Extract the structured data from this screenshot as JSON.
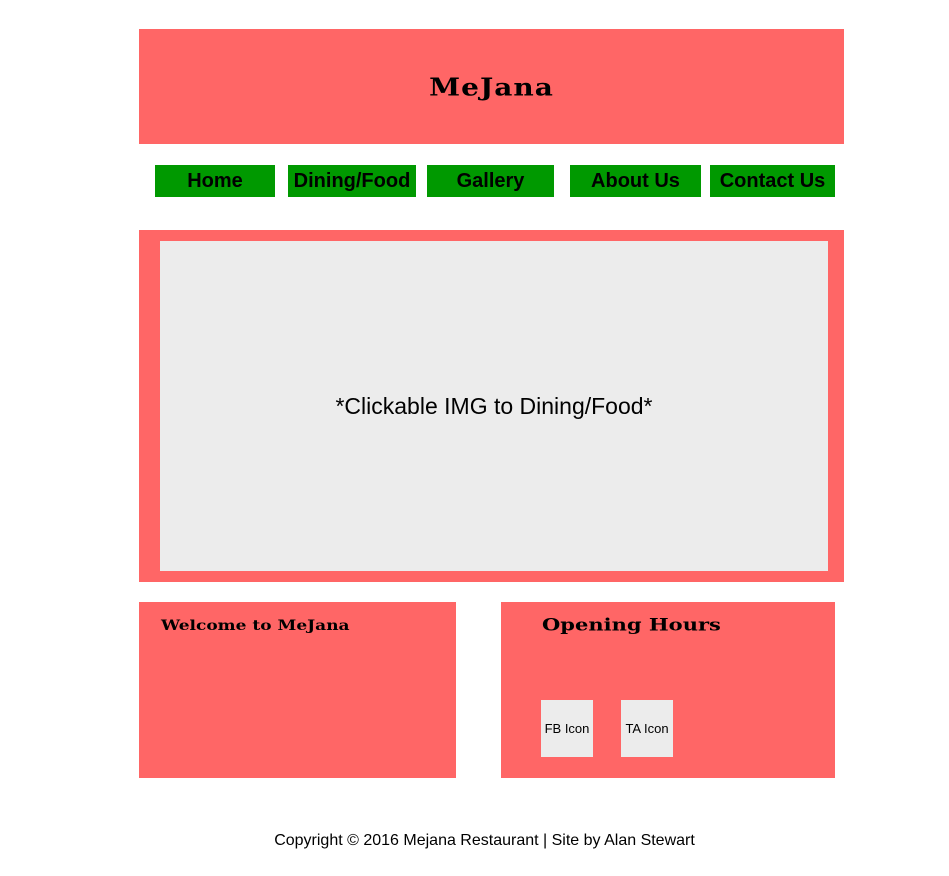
{
  "header": {
    "title": "MeJana"
  },
  "nav": {
    "items": [
      {
        "label": "Home"
      },
      {
        "label": "Dining/Food"
      },
      {
        "label": "Gallery"
      },
      {
        "label": "About Us"
      },
      {
        "label": "Contact Us"
      }
    ]
  },
  "hero": {
    "placeholder": "*Clickable IMG to Dining/Food*"
  },
  "welcome": {
    "heading": "Welcome to MeJana"
  },
  "hours": {
    "heading": "Opening Hours",
    "icons": [
      {
        "label": "FB Icon"
      },
      {
        "label": "TA Icon"
      }
    ]
  },
  "footer": {
    "text": "Copyright © 2016 Mejana Restaurant | Site by Alan Stewart"
  },
  "colors": {
    "panel": "#ff6666",
    "nav": "#009900",
    "placeholder": "#ececec"
  }
}
